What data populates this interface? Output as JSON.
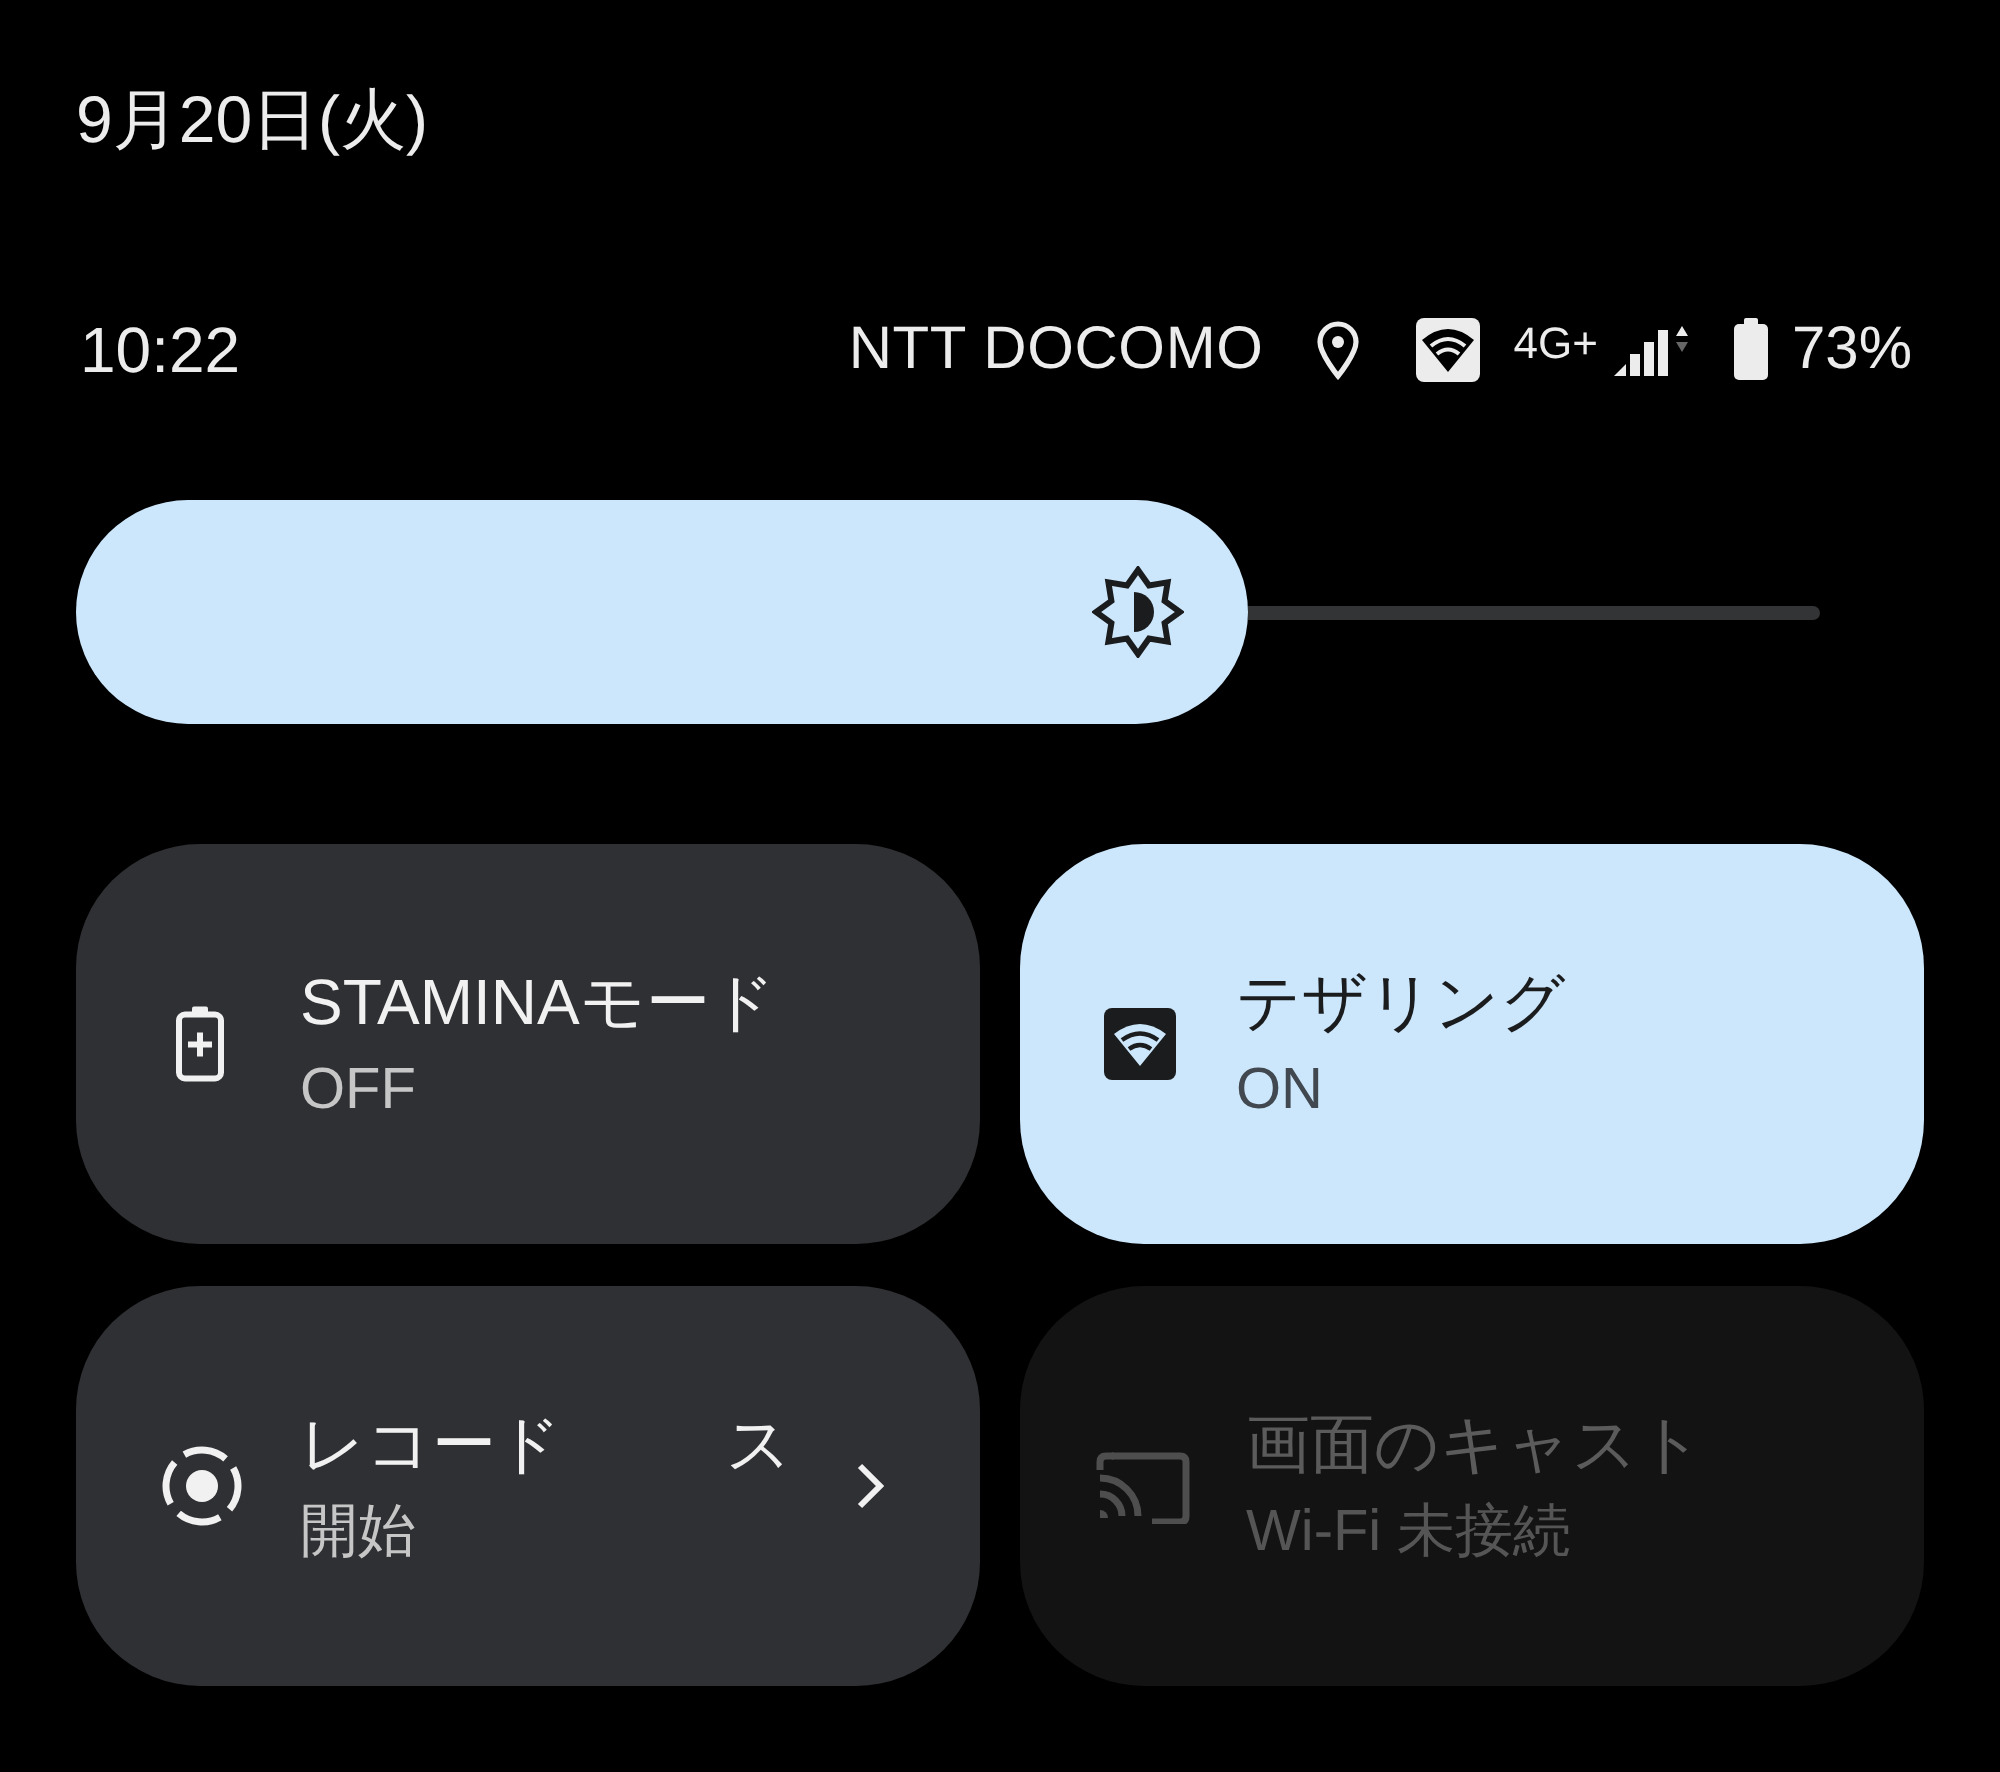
{
  "date": "9月20日(火)",
  "status_bar": {
    "time": "10:22",
    "carrier": "NTT DOCOMO",
    "network": "4G+",
    "battery": "73%"
  },
  "brightness": {
    "level": 0.67
  },
  "tiles": [
    {
      "kind": "battery-saver",
      "title": "STAMINAモード",
      "subtitle": "OFF",
      "on": false,
      "disabled": false,
      "chevron": false
    },
    {
      "kind": "hotspot",
      "title": "テザリング",
      "subtitle": "ON",
      "on": true,
      "disabled": false,
      "chevron": false
    },
    {
      "kind": "screen-record",
      "title": "レコード　　  ス",
      "subtitle": "開始",
      "on": false,
      "disabled": false,
      "chevron": true
    },
    {
      "kind": "cast",
      "title": "画面のキャスト",
      "subtitle": "Wi-Fi 未接続",
      "on": false,
      "disabled": true,
      "chevron": false
    }
  ]
}
